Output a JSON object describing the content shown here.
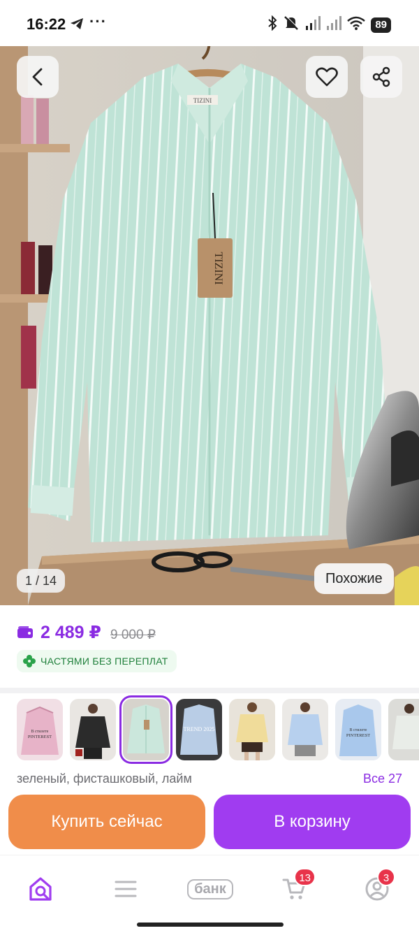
{
  "status_bar": {
    "time": "16:22",
    "more": "···",
    "battery": "89",
    "icons": [
      "telegram-icon",
      "bluetooth-icon",
      "mute-icon",
      "signal-icon",
      "signal-icon",
      "wifi-icon",
      "battery-icon"
    ]
  },
  "hero": {
    "counter": "1 / 14",
    "similar_label": "Похожие",
    "brand_tag": "TIZINI",
    "colors": {
      "shirt": "#bfe3d6",
      "stripe": "#ffffff",
      "table": "#b28f6e",
      "wall": "#d7d3cc"
    }
  },
  "price": {
    "current": "2 489 ₽",
    "old": "9 000 ₽",
    "installments": "ЧАСТЯМИ БЕЗ ПЕРЕПЛАТ"
  },
  "variants": {
    "thumbs": [
      {
        "name": "pink-shirt",
        "color": "#e7b3c8",
        "text": "В стилете PINTEREST",
        "selected": false
      },
      {
        "name": "black-shirt",
        "color": "#2b2b2b",
        "text": "",
        "selected": false
      },
      {
        "name": "mint-shirt",
        "color": "#cbe7dc",
        "text": "",
        "selected": true
      },
      {
        "name": "blue-stripe-shirt",
        "color": "#b9cde6",
        "text": "TREND 2025",
        "selected": false
      },
      {
        "name": "yellow-shirt",
        "color": "#f0dc9a",
        "text": "",
        "selected": false
      },
      {
        "name": "lightblue-shirt",
        "color": "#b7d0ee",
        "text": "",
        "selected": false
      },
      {
        "name": "blue-shirt-pinterest",
        "color": "#a9c8ec",
        "text": "В стилете PINTEREST",
        "selected": false
      },
      {
        "name": "white-shirt",
        "color": "#e9ede8",
        "text": "",
        "selected": false
      }
    ],
    "color_name": "зеленый, фисташковый, лайм",
    "all_label": "Все 27"
  },
  "actions": {
    "buy_now": "Купить сейчас",
    "add_to_cart": "В корзину"
  },
  "nav": {
    "bank_label": "банк",
    "cart_badge": "13",
    "profile_badge": "3"
  },
  "theme": {
    "accent": "#a03cf0",
    "buy": "#f08d4a",
    "badge": "#e8334a"
  }
}
